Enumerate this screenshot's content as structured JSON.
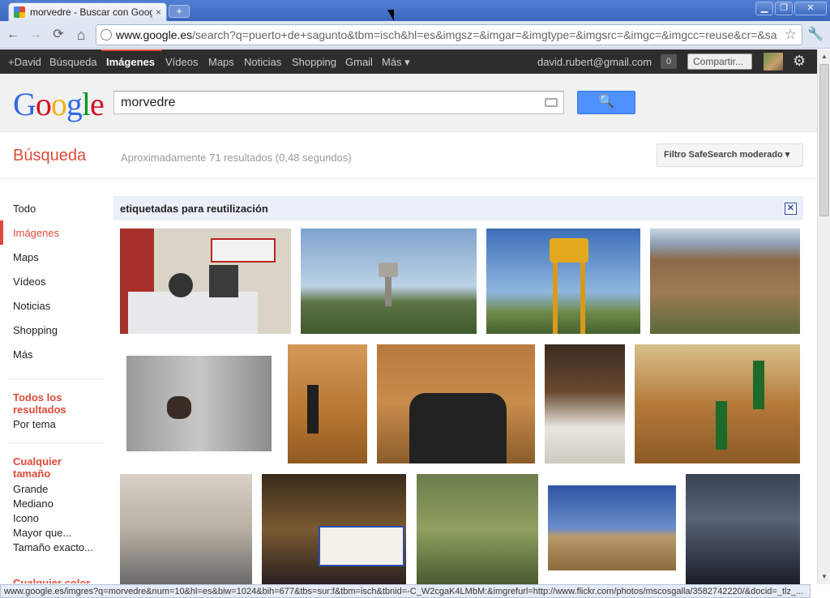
{
  "browser": {
    "tab_title": "morvedre - Buscar con Google",
    "tab_close": "×",
    "new_tab": "+",
    "url_host": "www.google.es",
    "url_rest": "/search?q=puerto+de+sagunto&tbm=isch&hl=es&imgsz=&imgar=&imgtype=&imgsrc=&imgc=&imgcc=reuse&cr=&sa",
    "back": "←",
    "forward": "→",
    "reload": "⟳",
    "home": "⌂",
    "star": "☆",
    "wrench": "🔧",
    "minimize": "▁",
    "maximize": "❐",
    "close": "✕"
  },
  "gbar": {
    "items": [
      "+David",
      "Búsqueda",
      "Imágenes",
      "Vídeos",
      "Maps",
      "Noticias",
      "Shopping",
      "Gmail",
      "Más ▾"
    ],
    "email": "david.rubert@gmail.com",
    "count": "0",
    "share": "Compartir...",
    "gear": "⚙"
  },
  "search": {
    "logo": [
      "G",
      "o",
      "o",
      "g",
      "l",
      "e"
    ],
    "query": "morvedre",
    "button_icon": "🔍"
  },
  "results": {
    "section": "Búsqueda",
    "stats": "Aproximadamente 71 resultados (0,48 segundos)",
    "safesearch": "Filtro SafeSearch moderado ▾",
    "banner": "etiquetadas para reutilización",
    "banner_close": "✕"
  },
  "left_nav": {
    "items": [
      "Todo",
      "Imágenes",
      "Maps",
      "Vídeos",
      "Noticias",
      "Shopping",
      "Más"
    ],
    "all_results_head": "Todos los resultados",
    "by_topic": "Por tema",
    "size_head": "Cualquier tamaño",
    "sizes": [
      "Grande",
      "Mediano",
      "Icono",
      "Mayor que...",
      "Tamaño exacto..."
    ],
    "color_head": "Cualquier color"
  },
  "status_bar": "www.google.es/imgres?q=morvedre&num=10&hl=es&biw=1024&bih=677&tbs=sur:f&tbm=isch&tbnid=-C_W2cgaK4LMbM:&imgrefurl=http://www.flickr.com/photos/mscosgalla/3582742220/&docid=_tlz_..."
}
